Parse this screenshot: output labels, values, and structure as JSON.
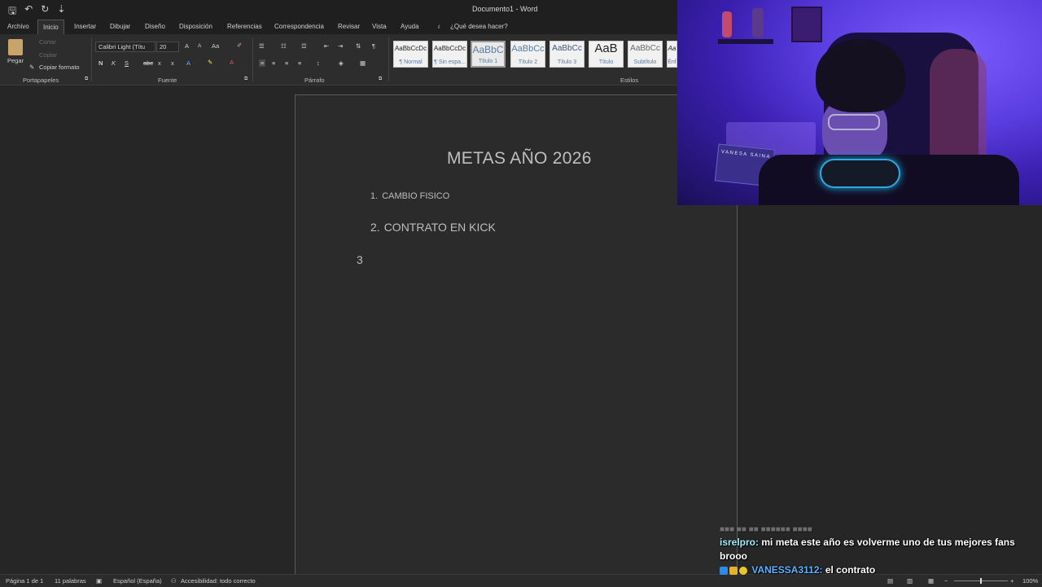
{
  "window": {
    "title": "Documento1 - Word"
  },
  "quick_access": {
    "save_icon": "save-icon",
    "undo_icon": "undo-icon",
    "redo_icon": "redo-icon",
    "more": "⇣"
  },
  "tabs": [
    {
      "label": "Archivo"
    },
    {
      "label": "Inicio"
    },
    {
      "label": "Insertar"
    },
    {
      "label": "Dibujar"
    },
    {
      "label": "Diseño"
    },
    {
      "label": "Disposición"
    },
    {
      "label": "Referencias"
    },
    {
      "label": "Correspondencia"
    },
    {
      "label": "Revisar"
    },
    {
      "label": "Vista"
    },
    {
      "label": "Ayuda"
    }
  ],
  "tell_me": {
    "placeholder": "¿Qué desea hacer?"
  },
  "clipboard": {
    "paste": "Pegar",
    "cut": "Cortar",
    "copy": "Copiar",
    "format_painter": "Copiar formato",
    "group": "Portapapeles"
  },
  "font": {
    "name": "Calibri Light (Títu",
    "size": "20",
    "grow": "A",
    "shrink": "A",
    "case": "Aa",
    "bold": "N",
    "italic": "K",
    "underline": "S",
    "strike": "abc",
    "subscript": "x",
    "superscript": "x",
    "group": "Fuente"
  },
  "paragraph": {
    "group": "Párrafo",
    "pilcrow": "¶"
  },
  "styles": {
    "group": "Estilos",
    "items": [
      {
        "sample": "AaBbCcDc",
        "name": "¶ Normal"
      },
      {
        "sample": "AaBbCcDc",
        "name": "¶ Sin espa..."
      },
      {
        "sample": "AaBbC",
        "name": "Título 1"
      },
      {
        "sample": "AaBbCc",
        "name": "Título 2"
      },
      {
        "sample": "AaBbCc",
        "name": "Título 3"
      },
      {
        "sample": "AaB",
        "name": "Título"
      },
      {
        "sample": "AaBbCc",
        "name": "Subtítulo"
      },
      {
        "sample": "Aa",
        "name": "Énf"
      }
    ]
  },
  "document": {
    "heading": "METAS AÑO 2026",
    "list": [
      {
        "num": "1.",
        "text": "CAMBIO FISICO"
      },
      {
        "num": "2.",
        "text": "CONTRATO EN KICK"
      },
      {
        "num": "3",
        "text": ""
      }
    ]
  },
  "status": {
    "page": "Página 1 de 1",
    "words": "11 palabras",
    "language": "Español (España)",
    "accessibility": "Accesibilidad: todo correcto",
    "zoom": "100%"
  },
  "webcam": {
    "sign_text": "VANESA SAINA"
  },
  "chat": {
    "messages": [
      {
        "user": "isrelpro:",
        "text": "mi meta este año es volverme uno de tus mejores fans",
        "text2": "brooo"
      },
      {
        "user": "VANESSA3112:",
        "text": "el contrato"
      }
    ]
  },
  "colors": {
    "ribbon": "#2d2d2d",
    "page": "#2b2b2b",
    "chat_user1": "#9ef0ff",
    "chat_user2": "#5fb3ff"
  }
}
